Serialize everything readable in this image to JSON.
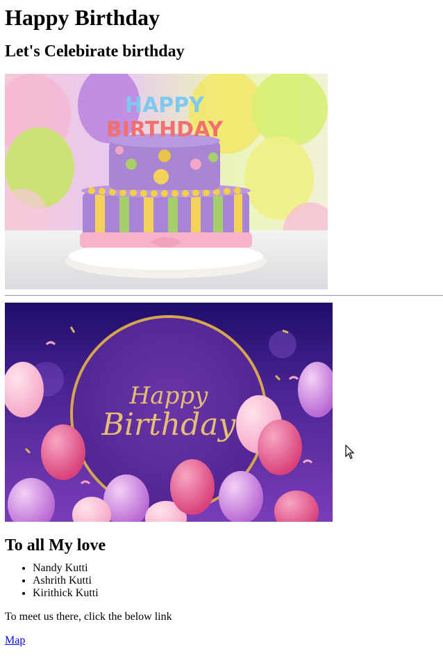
{
  "page": {
    "heading": "Happy Birthday",
    "subheading": "Let's Celebirate birthday"
  },
  "images": {
    "cake": {
      "cake_text_top": "HAPPY",
      "cake_text_bottom": "BIRTHDAY"
    },
    "card": {
      "script_line1": "Happy",
      "script_line2": "Birthday"
    }
  },
  "section": {
    "title": "To all My love",
    "names": [
      "Nandy Kutti",
      "Ashrith Kutti",
      "Kirithick Kutti"
    ]
  },
  "meet_text": "To meet us there, click the below link",
  "map_link": "Map",
  "colors": {
    "link": "#0000ee",
    "card_bg": "#4b2590",
    "gold": "#d6a64e"
  }
}
